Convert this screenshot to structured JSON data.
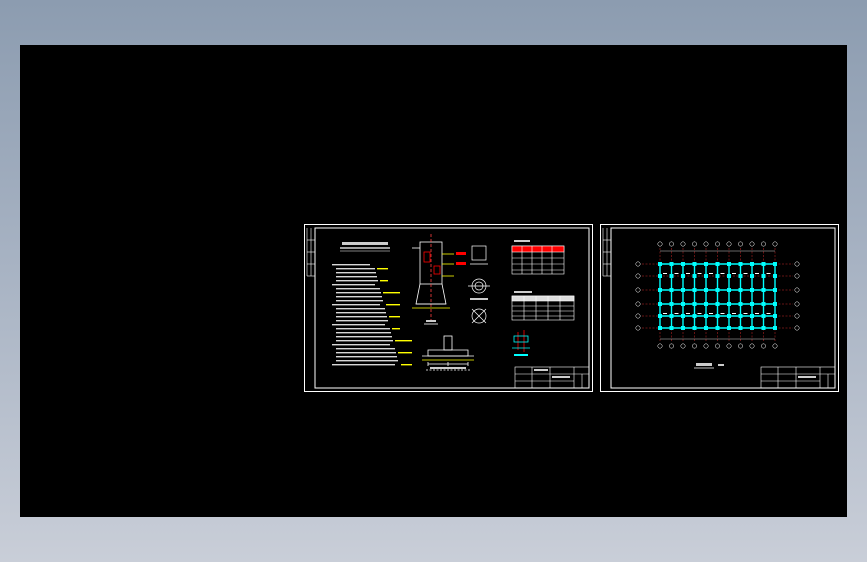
{
  "app": {
    "view": "model-space",
    "background_color": "#000000",
    "desktop_gradient": [
      "#8c9cb0",
      "#c9ced8"
    ]
  },
  "sheets": [
    {
      "id": "sheet-1",
      "kind": "foundation-detail",
      "frame_color": "#ffffff",
      "accent_colors": [
        "#ffff00",
        "#ff0000",
        "#00ffff",
        "#ffffff"
      ]
    },
    {
      "id": "sheet-2",
      "kind": "structural-plan",
      "frame_color": "#ffffff",
      "accent_colors": [
        "#00ffff",
        "#ff0000",
        "#ffffff"
      ]
    }
  ]
}
